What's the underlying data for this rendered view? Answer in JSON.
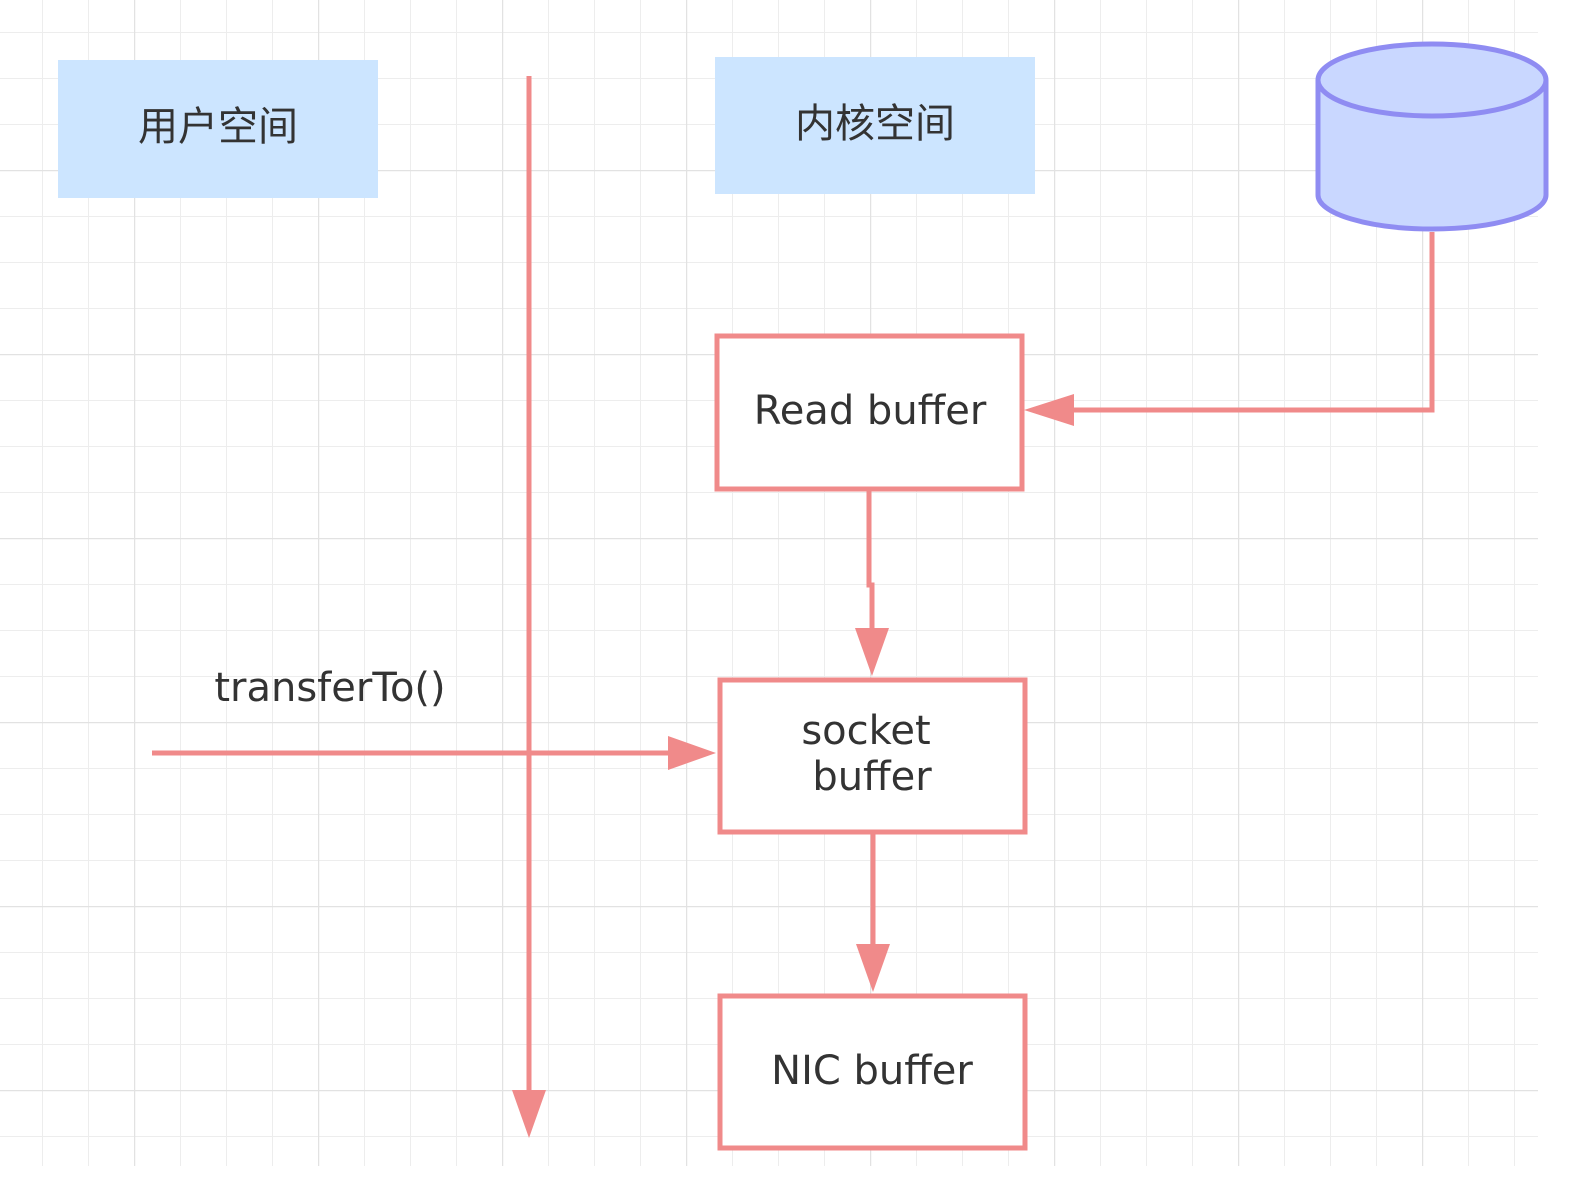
{
  "regions": {
    "user_space": "用户空间",
    "kernel_space": "内核空间"
  },
  "nodes": {
    "read_buffer": "Read buffer",
    "socket_buffer_line1": "socket",
    "socket_buffer_line2": "buffer",
    "nic_buffer": "NIC buffer"
  },
  "edges": {
    "transfer_call": "transferTo()"
  },
  "colors": {
    "grid": "#e9e9e9",
    "region_fill": "#cce5ff",
    "accent_stroke": "#f08a8a",
    "disk_fill": "#c9d7ff",
    "disk_stroke": "#8f8cf2",
    "text": "#333333"
  }
}
